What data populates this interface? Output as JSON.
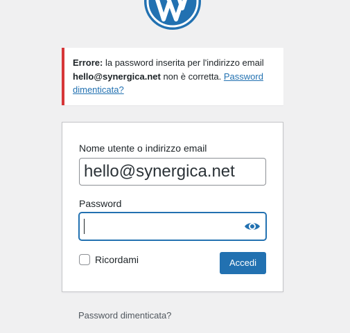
{
  "logo": {
    "icon": "wordpress-logo-icon"
  },
  "error_notice": {
    "error_label": "Errore:",
    "message_part1": " la password inserita per l'indirizzo email ",
    "email": "hello@synergica.net",
    "message_part2": " non è corretta. ",
    "lost_password_link": "Password dimenticata?"
  },
  "login_form": {
    "username_label": "Nome utente o indirizzo email",
    "username_value": "hello@synergica.net",
    "password_label": "Password",
    "password_value": "",
    "show_password_icon": "eye-icon",
    "remember_label": "Ricordami",
    "remember_checked": false,
    "submit_label": "Accedi"
  },
  "footer": {
    "lost_password": "Password dimenticata?"
  },
  "colors": {
    "background": "#f0f0f1",
    "accent": "#2271b1",
    "error": "#d63638"
  }
}
